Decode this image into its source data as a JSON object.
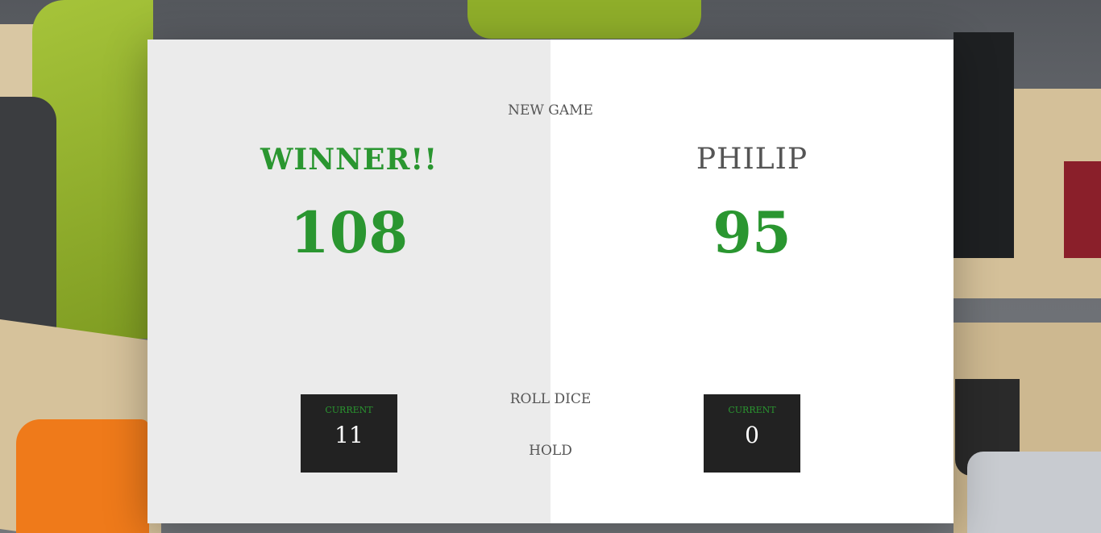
{
  "controls": {
    "new_game": "NEW GAME",
    "roll_dice": "ROLL DICE",
    "hold": "HOLD"
  },
  "players": [
    {
      "name": "WINNER!!",
      "score": "108",
      "current_label": "CURRENT",
      "current_score": "11",
      "is_winner": true
    },
    {
      "name": "PHILIP",
      "score": "95",
      "current_label": "CURRENT",
      "current_score": "0",
      "is_winner": false
    }
  ],
  "colors": {
    "accent": "#2a9630",
    "panel_left": "#ebebeb",
    "panel_right": "#ffffff",
    "current_box": "#222222",
    "text": "#555555"
  }
}
